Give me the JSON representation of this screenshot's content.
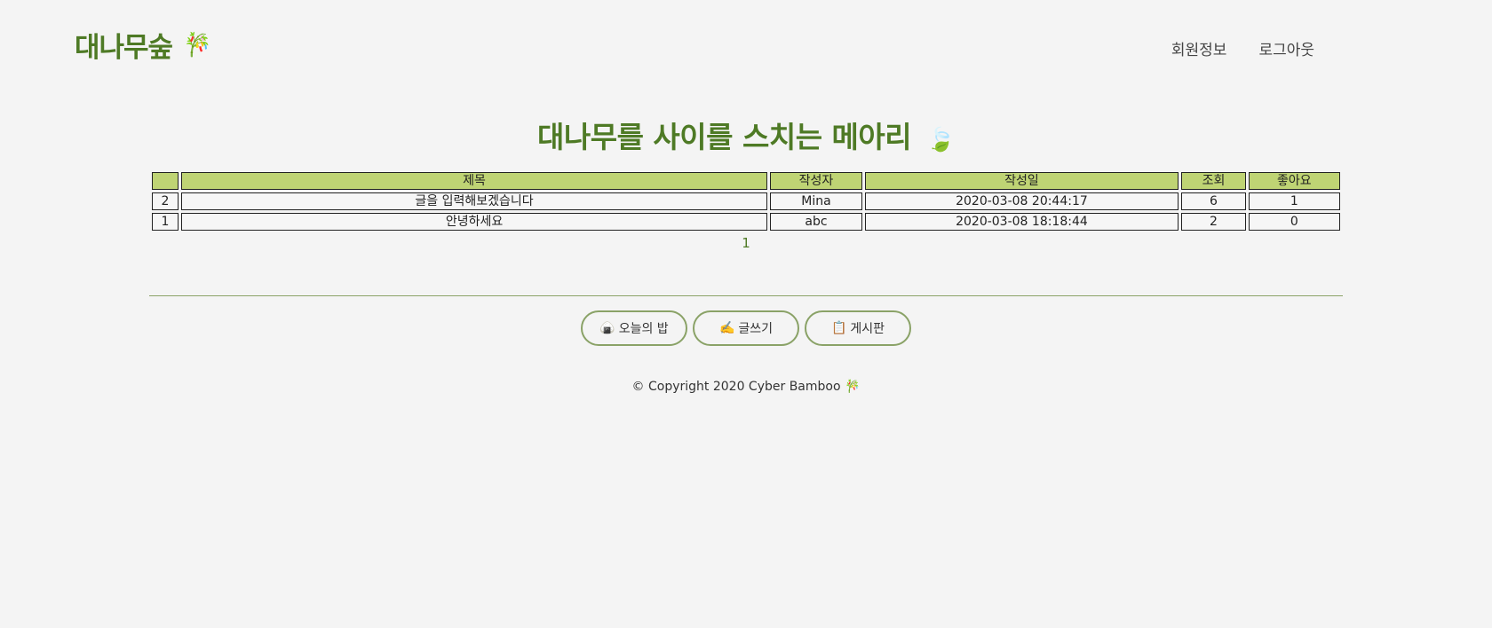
{
  "header": {
    "brand": "대나무숲",
    "brand_icon": "🎋",
    "nav": [
      "회원정보",
      "로그아웃"
    ]
  },
  "hero": {
    "title": "대나무를 사이를 스치는 메아리",
    "leaf_icon": "🍃"
  },
  "table": {
    "columns": [
      "",
      "제목",
      "작성자",
      "작성일",
      "조회",
      "좋아요"
    ],
    "rows": [
      [
        "2",
        "글을 입력해보겠습니다",
        "Mina",
        "2020-03-08 20:44:17",
        "6",
        "1"
      ],
      [
        "1",
        "안녕하세요",
        "abc",
        "2020-03-08 18:18:44",
        "2",
        "0"
      ]
    ]
  },
  "pager": {
    "pages": [
      "1"
    ]
  },
  "buttons": [
    {
      "icon": "🍙",
      "label": "오늘의 밥"
    },
    {
      "icon": "✍️",
      "label": "글쓰기"
    },
    {
      "icon": "📋",
      "label": "게시판"
    }
  ],
  "footer": {
    "text": "© Copyright 2020 Cyber Bamboo",
    "icon": "🎋"
  },
  "colors": {
    "brand_green": "#4e7a25",
    "header_row": "#bfd474",
    "pill_border": "#8aa267",
    "background": "#f4f4f4"
  }
}
